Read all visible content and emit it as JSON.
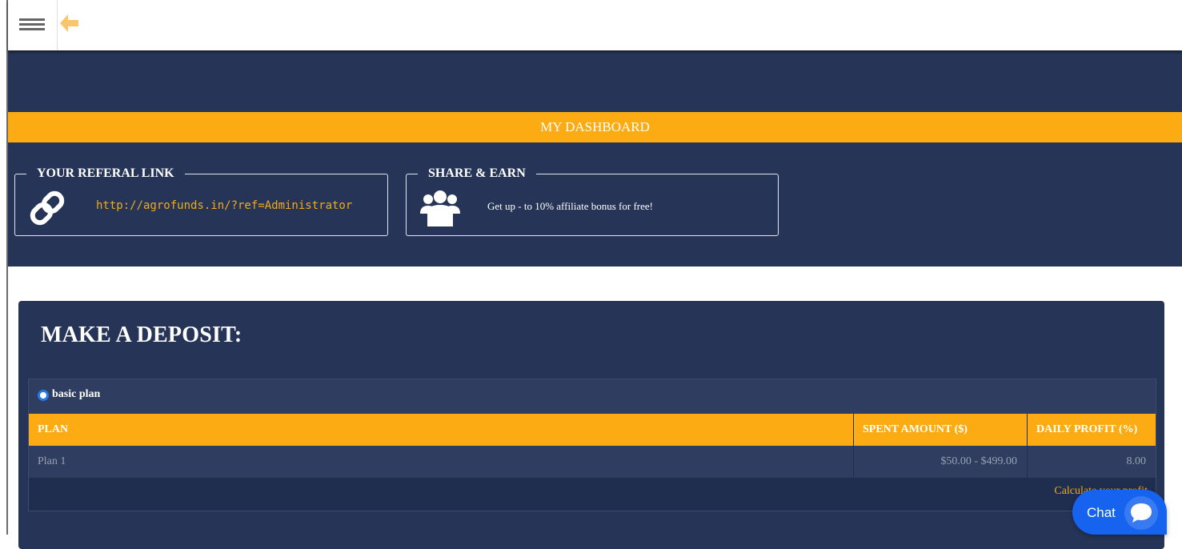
{
  "dashboard": {
    "title": "MY DASHBOARD"
  },
  "referral": {
    "legend": "YOUR REFERAL LINK",
    "link": "http://agrofunds.in/?ref=Administrator"
  },
  "share": {
    "legend": "SHARE & EARN",
    "text": "Get up - to 10% affiliate bonus for free!"
  },
  "deposit": {
    "heading": "MAKE A DEPOSIT:",
    "plan_option": "basic plan",
    "plan_selected": true,
    "columns": [
      "PLAN",
      "SPENT AMOUNT ($)",
      "DAILY PROFIT (%)"
    ],
    "rows": [
      [
        "Plan 1",
        "$50.00 - $499.00",
        "8.00"
      ]
    ],
    "calculate_label": "Calculate your profit"
  },
  "chat": {
    "label": "Chat"
  },
  "icons": {
    "menu": "hamburger-menu-icon",
    "back": "arrow-left-icon",
    "referral": "chain-link-icon",
    "share": "users-group-icon",
    "chat": "speech-bubble-icon"
  },
  "colors": {
    "navy": "#263557",
    "accent": "#fcac12",
    "link": "#f2aa17",
    "chat": "#1663f0"
  }
}
